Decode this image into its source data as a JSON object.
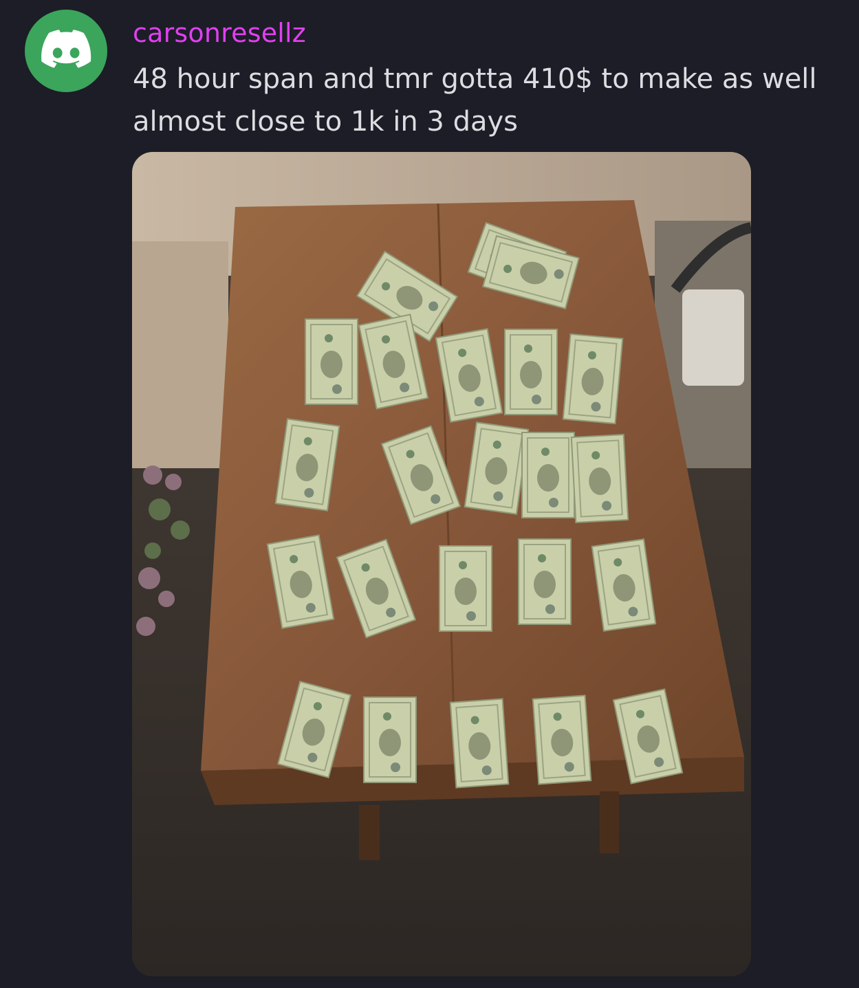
{
  "message": {
    "avatar_icon": "discord-logo-icon",
    "username": "carsonresellz",
    "lines": [
      "48 hour span and tmr gotta 410$ to make as well",
      "almost close to 1k in 3 days"
    ]
  },
  "attachment": {
    "icon": "photo-icon"
  },
  "colors": {
    "background": "#1c1d26",
    "avatar": "#3ba55c",
    "username": "#e040f0",
    "message_text": "#dbdee1",
    "table_wood": "#8a5a36",
    "bill_green": "#c8cfa8"
  }
}
